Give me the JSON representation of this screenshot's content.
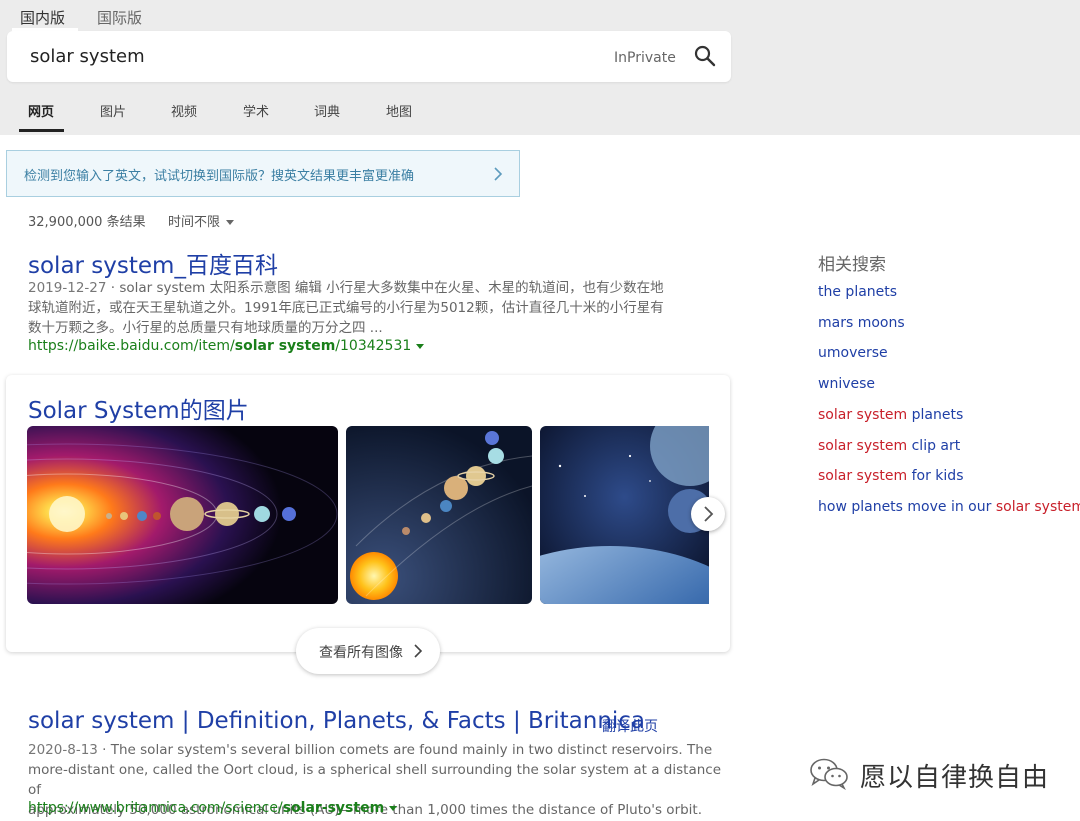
{
  "region_tabs": [
    "国内版",
    "国际版"
  ],
  "search": {
    "value": "solar system",
    "inprivate": "InPrivate"
  },
  "nav_tabs": [
    "网页",
    "图片",
    "视频",
    "学术",
    "词典",
    "地图"
  ],
  "notice": "检测到您输入了英文，试试切换到国际版？搜英文结果更丰富更准确",
  "result_count": "32,900,000 条结果",
  "time_filter": "时间不限",
  "results": [
    {
      "title": "solar system_百度百科",
      "date": "2019-12-27",
      "snippet_lines": [
        "solar system 太阳系示意图 编辑 小行星大多数集中在火星、木星的轨道间，也有少数在地",
        "球轨道附近，或在天王星轨道之外。1991年底已正式编号的小行星为5012颗，估计直径几十米的小行星有",
        "数十万颗之多。小行星的总质量只有地球质量的万分之四 ..."
      ],
      "url_prefix": "https://baike.baidu.com/item/",
      "url_bold": "solar system",
      "url_suffix": "/10342531"
    },
    {
      "title": "solar system | Definition, Planets, & Facts | Britannica",
      "translate": "翻译此页",
      "date": "2020-8-13",
      "snippet_lines": [
        "The solar system's several billion comets are found mainly in two distinct reservoirs. The",
        "more-distant one, called the Oort cloud, is a spherical shell surrounding the solar system at a distance of",
        "approximately 50,000 astronomical units (AU)—more than 1,000 times the distance of Pluto's orbit."
      ],
      "url_prefix": "https://www.britannica.com/science/",
      "url_bold": "solar-system",
      "url_suffix": ""
    }
  ],
  "images_block": {
    "title": "Solar System的图片",
    "view_all": "查看所有图像"
  },
  "related": {
    "heading": "相关搜索",
    "items": [
      {
        "pre": "the planets",
        "hl": "",
        "post": ""
      },
      {
        "pre": "mars moons",
        "hl": "",
        "post": ""
      },
      {
        "pre": "umoverse",
        "hl": "",
        "post": ""
      },
      {
        "pre": "wnivese",
        "hl": "",
        "post": ""
      },
      {
        "pre": "",
        "hl": "solar system",
        "post": " planets"
      },
      {
        "pre": "",
        "hl": "solar system",
        "post": " clip art"
      },
      {
        "pre": "",
        "hl": "solar system",
        "post": " for kids"
      },
      {
        "pre": "how planets move in our ",
        "hl": "solar system",
        "post": ""
      }
    ]
  },
  "watermark": "愿以自律换自由",
  "colors": {
    "link": "#1f3fa6",
    "url_green": "#1a7f1a",
    "highlight": "#c8202a",
    "header_bg": "#ececec",
    "notice_bg": "#eff7fb"
  }
}
